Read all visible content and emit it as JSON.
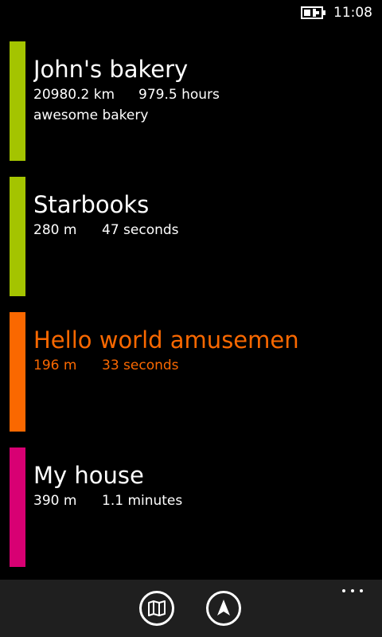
{
  "status_bar": {
    "time": "11:08",
    "battery_icon": "battery-charging-icon"
  },
  "places": [
    {
      "name": "John's bakery",
      "distance": "20980.2 km",
      "duration": "979.5 hours",
      "description": "awesome bakery",
      "color": "#a4c400",
      "text_color": "#ffffff"
    },
    {
      "name": "Starbooks",
      "distance": "280 m",
      "duration": "47 seconds",
      "description": "",
      "color": "#a4c400",
      "text_color": "#ffffff"
    },
    {
      "name": "Hello world amusement",
      "distance": "196 m",
      "duration": "33 seconds",
      "description": "",
      "color": "#fa6800",
      "text_color": "#fa6800"
    },
    {
      "name": "My house",
      "distance": "390 m",
      "duration": "1.1 minutes",
      "description": "",
      "color": "#d80073",
      "text_color": "#ffffff"
    }
  ],
  "app_bar": {
    "buttons": [
      {
        "icon": "map-icon"
      },
      {
        "icon": "navigation-arrow-icon"
      }
    ],
    "more_icon": "ellipsis-icon"
  }
}
